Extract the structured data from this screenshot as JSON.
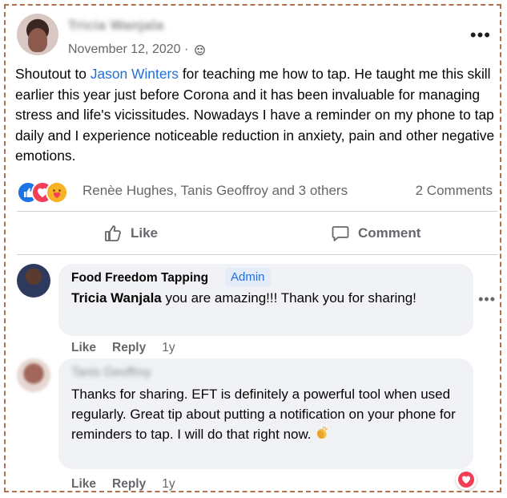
{
  "post": {
    "author_name": "Tricia Wanjala",
    "date": "November 12, 2020 ·",
    "more_label": "•••",
    "text_prefix": "Shoutout to ",
    "mention": "Jason Winters",
    "text_suffix": " for teaching me how to tap. He taught me this skill earlier this year just before Corona and it has been invaluable for managing stress and life's vicissitudes. Nowadays I have a reminder on my phone to tap daily and I experience noticeable reduction in anxiety, pain and other negative emotions."
  },
  "reactions": {
    "icons": [
      "like-icon",
      "love-icon",
      "care-icon"
    ],
    "reactors": "Renèe Hughes, Tanis Geoffroy and 3 others",
    "comment_count": "2 Comments"
  },
  "actions": {
    "like_label": "Like",
    "comment_label": "Comment"
  },
  "comments": [
    {
      "author": "Food Freedom Tapping",
      "badge": "Admin",
      "mention": "Tricia Wanjala",
      "text": " you are amazing!!! Thank you for sharing!",
      "like_label": "Like",
      "reply_label": "Reply",
      "time": "1y",
      "more_label": "•••"
    },
    {
      "author": "Tanis Geoffroy",
      "text": "Thanks for sharing. EFT is definitely a powerful tool when used regularly. Great tip about putting a notification on your phone for reminders to tap. I will do that right now.",
      "emoji": "clapping-hands-icon",
      "reaction": "love-icon",
      "like_label": "Like",
      "reply_label": "Reply",
      "time": "1y"
    }
  ],
  "colors": {
    "mention": "#216fdb",
    "secondary_text": "#65676b",
    "bubble": "#f0f2f5",
    "frame_border": "#b2714d"
  }
}
